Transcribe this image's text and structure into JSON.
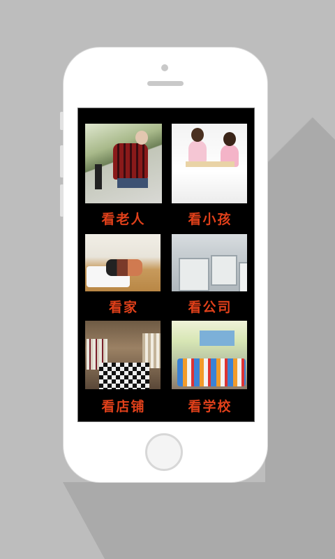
{
  "tiles": [
    {
      "label": "看老人",
      "image": "elderly-person-photo"
    },
    {
      "label": "看小孩",
      "image": "children-photo"
    },
    {
      "label": "看家",
      "image": "home-photo"
    },
    {
      "label": "看公司",
      "image": "office-photo"
    },
    {
      "label": "看店铺",
      "image": "shop-photo"
    },
    {
      "label": "看学校",
      "image": "school-photo"
    }
  ],
  "colors": {
    "background": "#bdbdbd",
    "phone_body": "#ffffff",
    "screen": "#000000",
    "caption": "#e0401a"
  }
}
